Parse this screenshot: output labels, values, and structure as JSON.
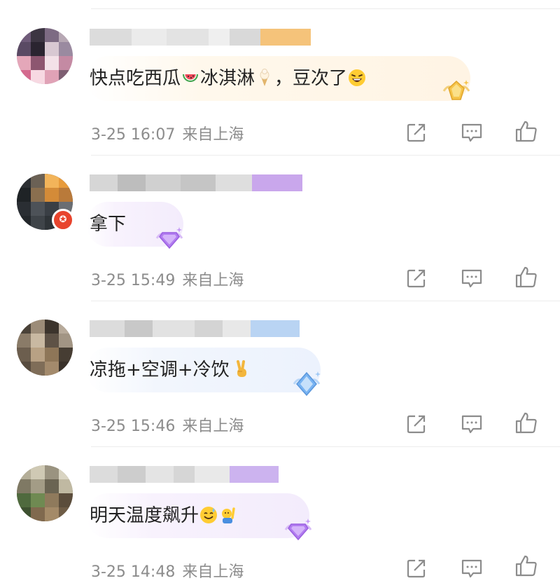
{
  "comments": [
    {
      "text": "快点吃西瓜",
      "text2": "冰淇淋",
      "text3": "，豆次了",
      "time": "3-25 16:07",
      "location": "来自上海",
      "emojis": [
        "watermelon-emoji",
        "ice-cream-emoji",
        "laughing-face-emoji"
      ],
      "badge_color": "#f4b94a"
    },
    {
      "text": "拿下",
      "time": "3-25 15:49",
      "location": "来自上海",
      "badge_color": "#a874f0"
    },
    {
      "text": "凉拖+空调+冷饮",
      "time": "3-25 15:46",
      "location": "来自上海",
      "emojis": [
        "victory-hand-emoji"
      ],
      "badge_color": "#6ba8f5"
    },
    {
      "text": "明天温度飙升",
      "time": "3-25 14:48",
      "location": "来自上海",
      "emojis": [
        "sweat-smile-emoji",
        "person-raising-hand-emoji"
      ],
      "badge_color": "#a874f0"
    }
  ],
  "icons": {
    "share": "share-icon",
    "comment": "comment-icon",
    "like": "thumbs-up-icon"
  },
  "colors": {
    "meta_text": "#8c8c8c",
    "comment_text": "#222222",
    "verified_badge": "#e8442d"
  }
}
